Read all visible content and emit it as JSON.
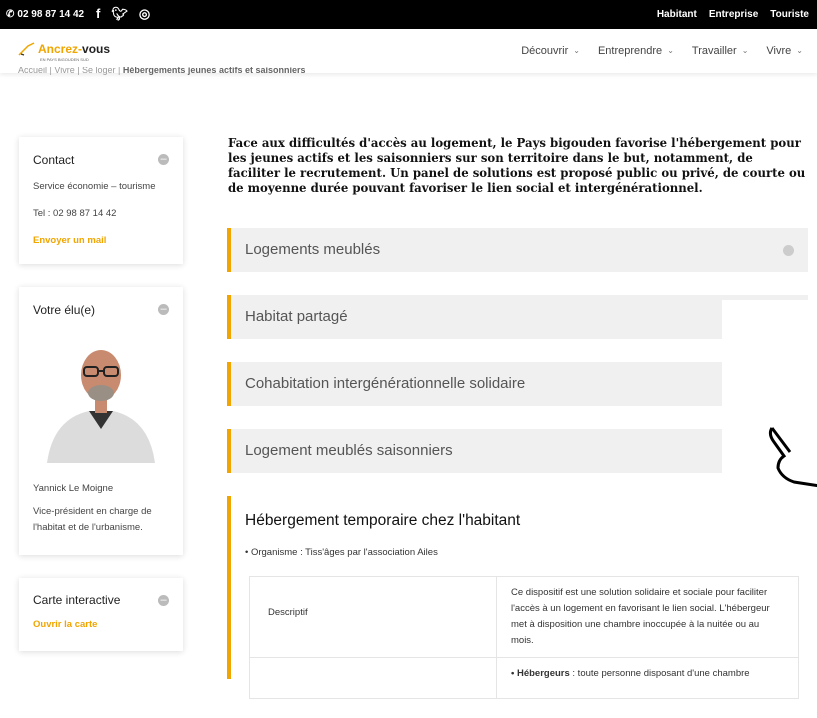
{
  "topbar": {
    "phone": "02 98 87 14 42",
    "links": [
      "Habitant",
      "Entreprise",
      "Touriste"
    ]
  },
  "logo": {
    "name_a": "Ancrez-",
    "name_b": "vous",
    "tagline": "EN PAYS BIGOUDEN SUD"
  },
  "nav": [
    "Découvrir",
    "Entreprendre",
    "Travailler",
    "Vivre"
  ],
  "breadcrumb": {
    "trail": "Accueil | Vivre | Se loger | ",
    "current": "Hébergements jeunes actifs et saisonniers"
  },
  "contact": {
    "title": "Contact",
    "service": "Service économie – tourisme",
    "tel": "Tel : 02 98 87 14 42",
    "mail": "Envoyer un mail"
  },
  "elu": {
    "title": "Votre élu(e)",
    "name": "Yannick Le Moigne",
    "role": "Vice-président en charge de l'habitat et de l'urbanisme."
  },
  "carte": {
    "title": "Carte interactive",
    "link": "Ouvrir la carte"
  },
  "intro": "Face aux difficultés d'accès au logement, le Pays bigouden favorise l'hébergement pour les jeunes actifs et les saisonniers sur son territoire dans le but, notamment, de faciliter le recrutement. Un panel de solutions est proposé public ou privé, de courte ou de moyenne durée pouvant favoriser le lien social et intergénérationnel.",
  "accordions": [
    "Logements meublés",
    "Habitat partagé",
    "Cohabitation intergénérationnelle solidaire",
    "Logement meublés saisonniers"
  ],
  "open": {
    "title": "Hébergement temporaire chez l'habitant",
    "org": "• Organisme : Tiss'âges par l'association Ailes",
    "rows": [
      {
        "key": "Descriptif",
        "value": "Ce dispositif est une solution solidaire et sociale pour faciliter l'accès à un logement en favorisant le lien social. L'hébergeur met à disposition une chambre inoccupée à la nuitée ou au mois."
      },
      {
        "key": "",
        "value_label": "• Hébergeurs",
        "value": " : toute personne disposant d'une chambre"
      }
    ]
  }
}
